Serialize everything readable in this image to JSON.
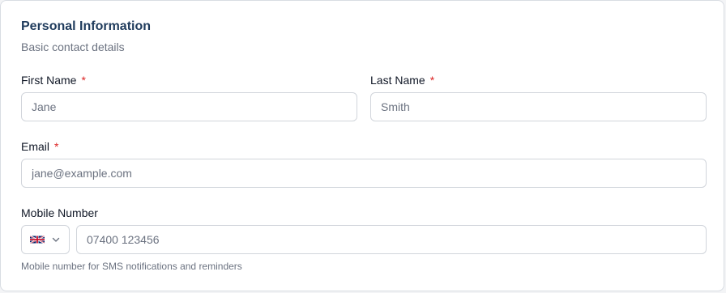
{
  "section": {
    "title": "Personal Information",
    "subtitle": "Basic contact details"
  },
  "fields": {
    "first_name": {
      "label": "First Name",
      "required_marker": "*",
      "placeholder": "Jane"
    },
    "last_name": {
      "label": "Last Name",
      "required_marker": "*",
      "placeholder": "Smith"
    },
    "email": {
      "label": "Email",
      "required_marker": "*",
      "placeholder": "jane@example.com"
    },
    "mobile": {
      "label": "Mobile Number",
      "placeholder": "07400 123456",
      "help": "Mobile number for SMS notifications and reminders",
      "country_flag_icon": "uk-flag-icon"
    }
  },
  "colors": {
    "title": "#1f3b5c",
    "required": "#dc2626",
    "border": "#d1d5db",
    "muted_text": "#6b7280"
  }
}
